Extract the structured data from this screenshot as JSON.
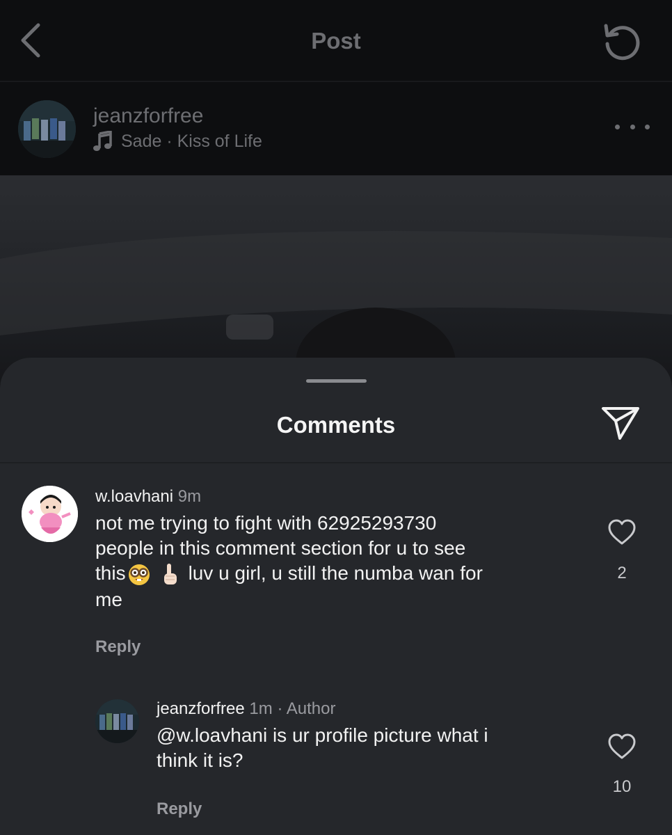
{
  "nav": {
    "title": "Post",
    "back_icon": "chevron-left-icon",
    "refresh_icon": "refresh-icon"
  },
  "post": {
    "username": "jeanzforfree",
    "music": "Sade · Kiss of Life",
    "music_icon": "music-note-icon",
    "more_icon": "more-horizontal-icon"
  },
  "comments_sheet": {
    "title": "Comments",
    "share_icon": "send-icon"
  },
  "comments": [
    {
      "username": "w.loavhani",
      "time": "9m",
      "text_line1": "not me trying to fight with 62925293730",
      "text_line2": "people in this comment section for u to see",
      "text_line3_a": "this",
      "text_line3_b": "luv u girl, u still the numba wan for",
      "text_line4": "me",
      "emojis": [
        "nerd-face-emoji",
        "index-pointing-up-emoji"
      ],
      "reply_label": "Reply",
      "likes": "2"
    },
    {
      "username": "jeanzforfree",
      "time": "1m",
      "author_badge": "· Author",
      "text_line1": "@w.loavhani is ur profile picture what i",
      "text_line2": "think it is?",
      "reply_label": "Reply",
      "likes": "10"
    }
  ]
}
